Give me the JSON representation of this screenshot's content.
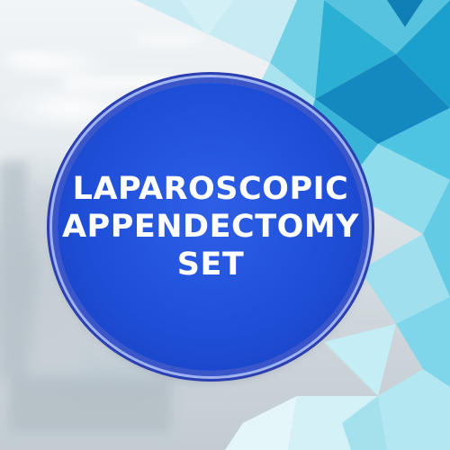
{
  "badge": {
    "lines": [
      "LAPAROSCOPIC",
      "APPENDECTOMY",
      "SET"
    ],
    "text_color": "#ffffff",
    "fill_color": "#1f4fd8"
  },
  "decoration": {
    "style": "teal-polygon-pattern",
    "accent_colors": [
      "#1fb6d6",
      "#63d3ea",
      "#a9e7f3",
      "#0e8fb8"
    ]
  },
  "background": {
    "style": "blurred-hospital-corridor"
  }
}
